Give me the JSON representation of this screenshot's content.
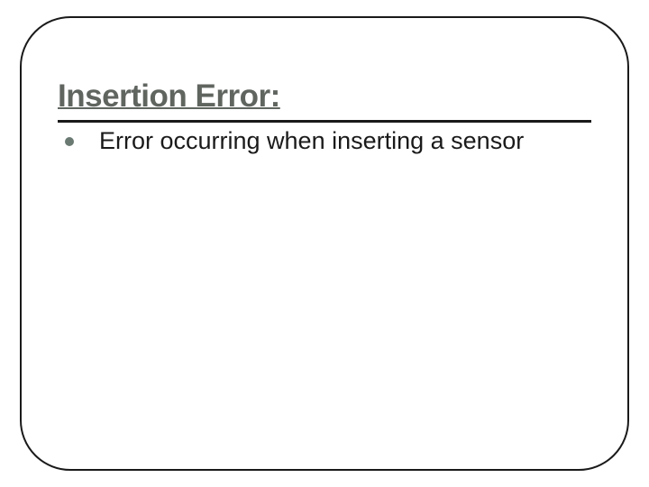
{
  "slide": {
    "title": "Insertion Error:",
    "bullets": [
      "Error occurring when inserting a sensor"
    ]
  }
}
